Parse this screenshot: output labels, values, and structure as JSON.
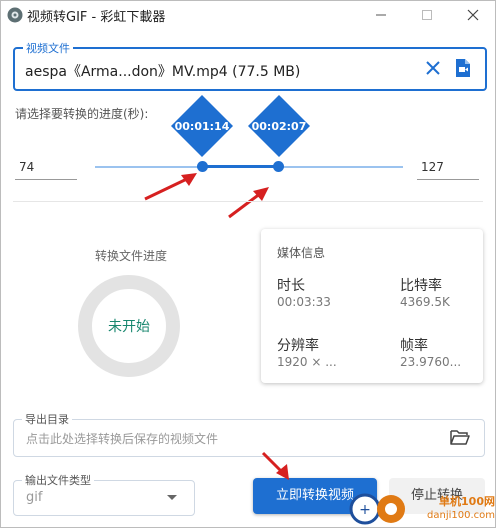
{
  "window": {
    "title": "视频转GIF - 彩虹下載器",
    "minimize_label": "—",
    "maximize_label": "☐",
    "close_label": "✕"
  },
  "file": {
    "legend": "视频文件",
    "name": "aespa《Arma...don》MV.mp4",
    "size": "(77.5 MB)",
    "clear_icon": "close-icon",
    "file_icon": "video-file-icon"
  },
  "range": {
    "label": "请选择要转换的进度(秒):",
    "start_value": "74",
    "end_value": "127",
    "start_time": "00:01:14",
    "end_time": "00:02:07",
    "slider_max": 213
  },
  "progress": {
    "title": "转换文件进度",
    "status": "未开始"
  },
  "media_info": {
    "title": "媒体信息",
    "duration_label": "时长",
    "duration_value": "00:03:33",
    "bitrate_label": "比特率",
    "bitrate_value": "4369.5K",
    "resolution_label": "分辨率",
    "resolution_value": "1920 × ...",
    "framerate_label": "帧率",
    "framerate_value": "23.9760..."
  },
  "output": {
    "legend": "导出目录",
    "placeholder": "点击此处选择转换后保存的视频文件",
    "folder_icon": "folder-open-icon"
  },
  "type": {
    "legend": "输出文件类型",
    "value": "gif"
  },
  "actions": {
    "convert_label": "立即转换视频",
    "stop_label": "停止转换"
  },
  "watermark": {
    "brand": "单机100网",
    "url": "danji100.com"
  },
  "colors": {
    "accent": "#1e6fd1",
    "status_green": "#17866e",
    "arrow_red": "#d62020"
  }
}
